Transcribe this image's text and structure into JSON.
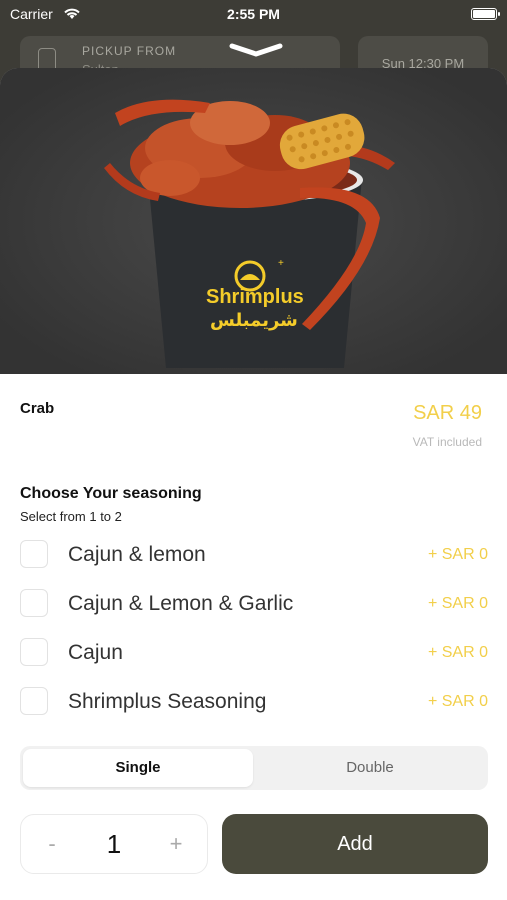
{
  "status_bar": {
    "carrier": "Carrier",
    "time": "2:55 PM"
  },
  "background": {
    "pickup_label": "PICKUP FROM",
    "store_name": "Sultan...",
    "slot_time": "Sun 12:30 PM"
  },
  "item": {
    "name": "Crab",
    "price": "SAR 49",
    "vat": "VAT included",
    "brand_latin": "Shrimplus",
    "brand_arabic": "شريمبلس"
  },
  "seasoning": {
    "title": "Choose Your seasoning",
    "subtitle": "Select from 1 to 2",
    "options": [
      {
        "label": "Cajun & lemon",
        "price": "+  SAR 0"
      },
      {
        "label": "Cajun & Lemon & Garlic",
        "price": "+  SAR 0"
      },
      {
        "label": "Cajun",
        "price": "+  SAR 0"
      },
      {
        "label": "Shrimplus Seasoning",
        "price": "+  SAR 0"
      }
    ]
  },
  "size": {
    "selected": "Single",
    "other": "Double"
  },
  "quantity": {
    "minus": "-",
    "value": "1",
    "plus": "+"
  },
  "add_button": "Add",
  "colors": {
    "accent": "#f2cf4a",
    "primary_button": "#4a4a3c"
  }
}
